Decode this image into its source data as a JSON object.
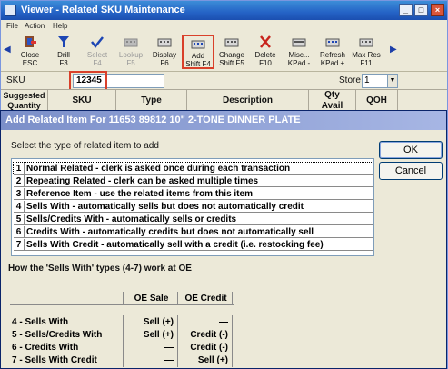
{
  "background": {
    "title": "Viewer - Related SKU Maintenance",
    "title_buttons": [
      "_",
      "□",
      "×"
    ],
    "menu": [
      "File",
      "Action",
      "Help"
    ],
    "toolbar": [
      {
        "l1": "Close",
        "l2": "ESC",
        "icon": "close-door-icon",
        "disabled": false
      },
      {
        "l1": "Drill",
        "l2": "F3",
        "icon": "drill-funnel-icon",
        "disabled": false
      },
      {
        "l1": "Select",
        "l2": "F4",
        "icon": "checkmark-icon",
        "disabled": true
      },
      {
        "l1": "Lookup",
        "l2": "F5",
        "icon": "lookup-keyboard-icon",
        "disabled": true
      },
      {
        "l1": "Display",
        "l2": "F6",
        "icon": "display-monitor-icon",
        "disabled": false
      },
      {
        "l1": "Add",
        "l2": "Shift F4",
        "icon": "add-keyboard-icon",
        "disabled": false
      },
      {
        "l1": "Change",
        "l2": "Shift F5",
        "icon": "change-keyboard-icon",
        "disabled": false
      },
      {
        "l1": "Delete",
        "l2": "F10",
        "icon": "delete-x-icon",
        "disabled": false
      },
      {
        "l1": "Misc...",
        "l2": "KPad -",
        "icon": "misc-keyboard-icon",
        "disabled": false
      },
      {
        "l1": "Refresh",
        "l2": "KPad +",
        "icon": "refresh-icon",
        "disabled": false
      },
      {
        "l1": "Max Res",
        "l2": "F11",
        "icon": "max-res-icon",
        "disabled": false
      }
    ],
    "sku_label": "SKU",
    "sku_value": "12345",
    "store_label": "Store",
    "store_value": "1",
    "columns": [
      "Suggested Quantity",
      "SKU",
      "Type",
      "Description",
      "Qty Avail",
      "QOH"
    ]
  },
  "dialog": {
    "title": "Add Related Item For 11653 89812 10\" 2-TONE DINNER PLATE",
    "prompt": "Select the type of related item to add",
    "options": [
      {
        "num": "1",
        "text": "Normal Related - clerk is asked once during each transaction"
      },
      {
        "num": "2",
        "text": "Repeating Related - clerk can be asked multiple times"
      },
      {
        "num": "3",
        "text": "Reference Item - use the related items from this item"
      },
      {
        "num": "4",
        "text": "Sells With - automatically sells but does not automatically credit"
      },
      {
        "num": "5",
        "text": "Sells/Credits With - automatically sells or credits"
      },
      {
        "num": "6",
        "text": "Credits With - automatically credits but does not automatically sell"
      },
      {
        "num": "7",
        "text": "Sells With Credit - automatically sell with a credit (i.e. restocking fee)"
      }
    ],
    "ok_label": "OK",
    "cancel_label": "Cancel",
    "explain": "How the 'Sells With' types (4-7) work at OE",
    "table": {
      "headers": [
        "",
        "OE Sale",
        "OE Credit"
      ],
      "rows": [
        [
          "4 - Sells With",
          "Sell (+)",
          "—"
        ],
        [
          "5 - Sells/Credits With",
          "Sell (+)",
          "Credit (-)"
        ],
        [
          "6 - Credits With",
          "—",
          "Credit (-)"
        ],
        [
          "7 - Sells With Credit",
          "—",
          "Sell (+)"
        ]
      ]
    }
  },
  "colors": {
    "titlebar": "#2563c6",
    "dialog_titlebar": "#7b8fc9",
    "highlight_box": "#d9402a",
    "window_bg": "#ece9d8"
  }
}
